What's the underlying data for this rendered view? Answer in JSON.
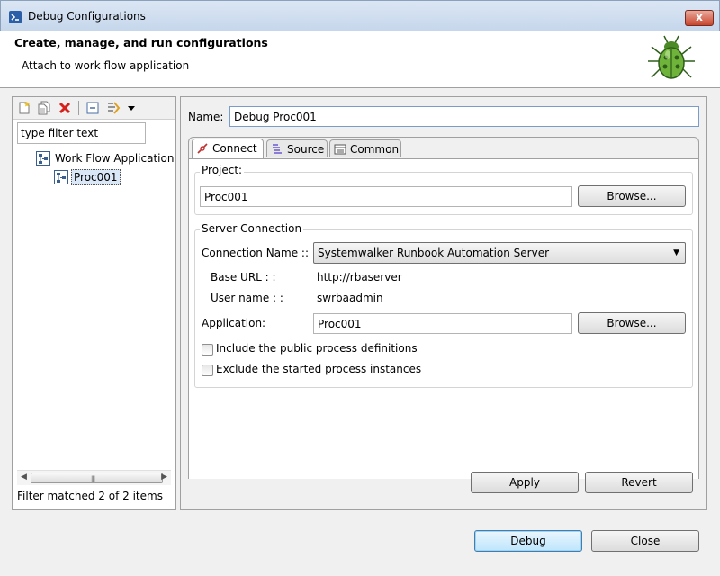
{
  "window": {
    "title": "Debug Configurations",
    "close_glyph": "x"
  },
  "banner": {
    "heading": "Create, manage, and run configurations",
    "subheading": "Attach to work flow application",
    "illustration": "bug-icon"
  },
  "left": {
    "toolbar": [
      "new-config-icon",
      "duplicate-icon",
      "delete-icon",
      "collapse-all-icon",
      "filter-icon",
      "view-menu-icon"
    ],
    "filter_placeholder": "type filter text",
    "filter_value": "type filter text",
    "tree": [
      {
        "label": "Work Flow Application",
        "icon": "workflow-icon",
        "level": 0,
        "selected": false
      },
      {
        "label": "Proc001",
        "icon": "workflow-icon",
        "level": 1,
        "selected": true
      }
    ],
    "status": "Filter matched 2 of 2 items"
  },
  "right": {
    "name_label": "Name:",
    "name_value": "Debug Proc001",
    "tabs": [
      {
        "label": "Connect",
        "icon": "connect-icon",
        "active": true
      },
      {
        "label": "Source",
        "icon": "source-icon",
        "active": false
      },
      {
        "label": "Common",
        "icon": "common-icon",
        "active": false
      }
    ],
    "project": {
      "title": "Project:",
      "value": "Proc001",
      "browse_label": "Browse..."
    },
    "server": {
      "title": "Server Connection",
      "connection_label": "Connection Name ::",
      "connection_value": "Systemwalker Runbook Automation Server",
      "base_url_label": "Base URL : :",
      "base_url_value": "http://rbaserver",
      "user_label": "User name : :",
      "user_value": "swrbaadmin",
      "application_label": "Application:",
      "application_value": "Proc001",
      "browse_label": "Browse...",
      "include_public_label": "Include the public process definitions",
      "include_public_checked": false,
      "exclude_started_label": "Exclude the started process instances",
      "exclude_started_checked": false
    },
    "apply_label": "Apply",
    "revert_label": "Revert"
  },
  "footer": {
    "debug_label": "Debug",
    "close_label": "Close"
  }
}
